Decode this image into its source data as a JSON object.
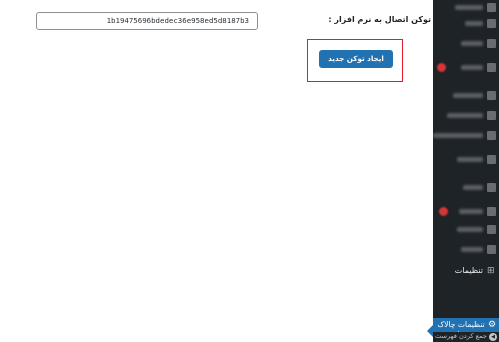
{
  "form": {
    "token_label": "توکن اتصال به نرم افزار :",
    "token_value": "1b19475696bdedec36e958ed5d8187b3",
    "generate_button": "ایجاد توکن جدید"
  },
  "sidebar": {
    "settings_label": "تنظیمات",
    "active_item_label": "تنظیمات چالاک حساب",
    "next_item_label": "جمع کردن فهرست"
  },
  "colors": {
    "primary": "#2271b1",
    "sidebar_bg": "#1d2327",
    "highlight": "#e21c2b"
  }
}
